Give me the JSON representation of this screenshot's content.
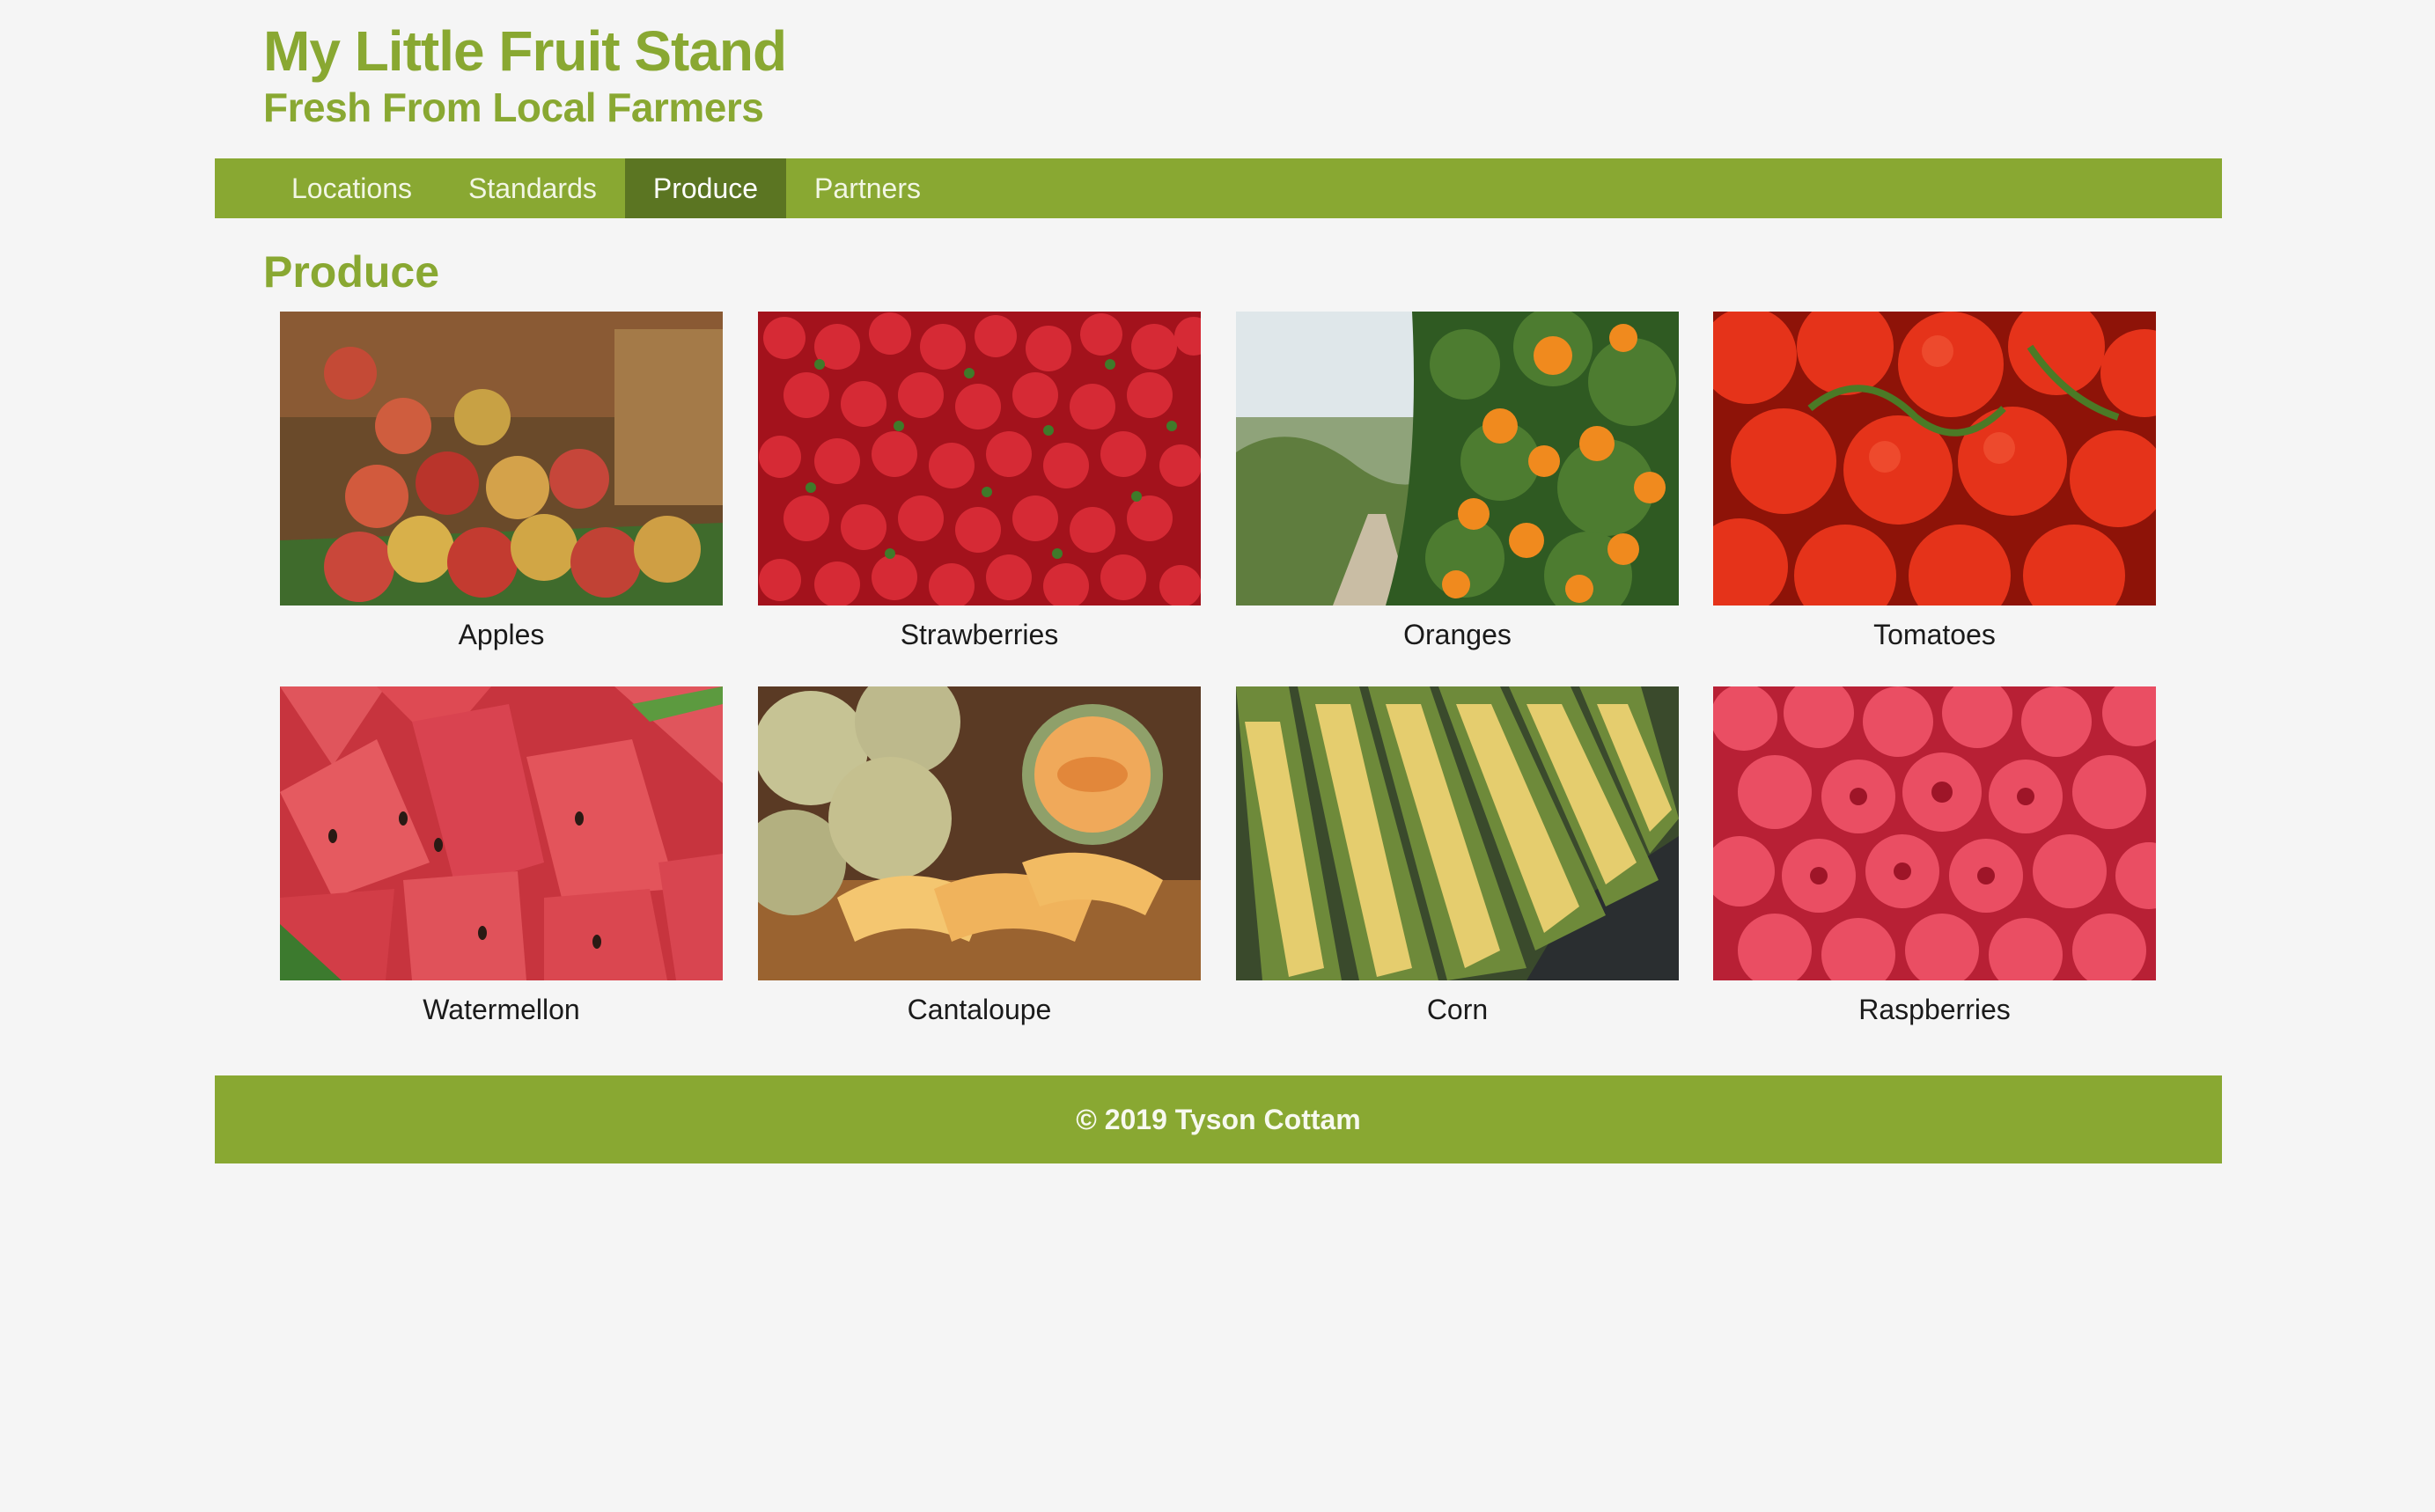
{
  "header": {
    "title": "My Little Fruit Stand",
    "tagline": "Fresh From Local Farmers"
  },
  "nav": {
    "items": [
      {
        "label": "Locations",
        "active": false
      },
      {
        "label": "Standards",
        "active": false
      },
      {
        "label": "Produce",
        "active": true
      },
      {
        "label": "Partners",
        "active": false
      }
    ]
  },
  "main": {
    "heading": "Produce",
    "products": [
      {
        "name": "Apples",
        "icon": "apples-photo"
      },
      {
        "name": "Strawberries",
        "icon": "strawberries-photo"
      },
      {
        "name": "Oranges",
        "icon": "oranges-photo"
      },
      {
        "name": "Tomatoes",
        "icon": "tomatoes-photo"
      },
      {
        "name": "Watermellon",
        "icon": "watermelon-photo"
      },
      {
        "name": "Cantaloupe",
        "icon": "cantaloupe-photo"
      },
      {
        "name": "Corn",
        "icon": "corn-photo"
      },
      {
        "name": "Raspberries",
        "icon": "raspberries-photo"
      }
    ]
  },
  "footer": {
    "text": "© 2019 Tyson Cottam"
  },
  "colors": {
    "brand_green": "#89a832",
    "nav_active": "#5b7522",
    "page_background": "#f5f5f5"
  }
}
